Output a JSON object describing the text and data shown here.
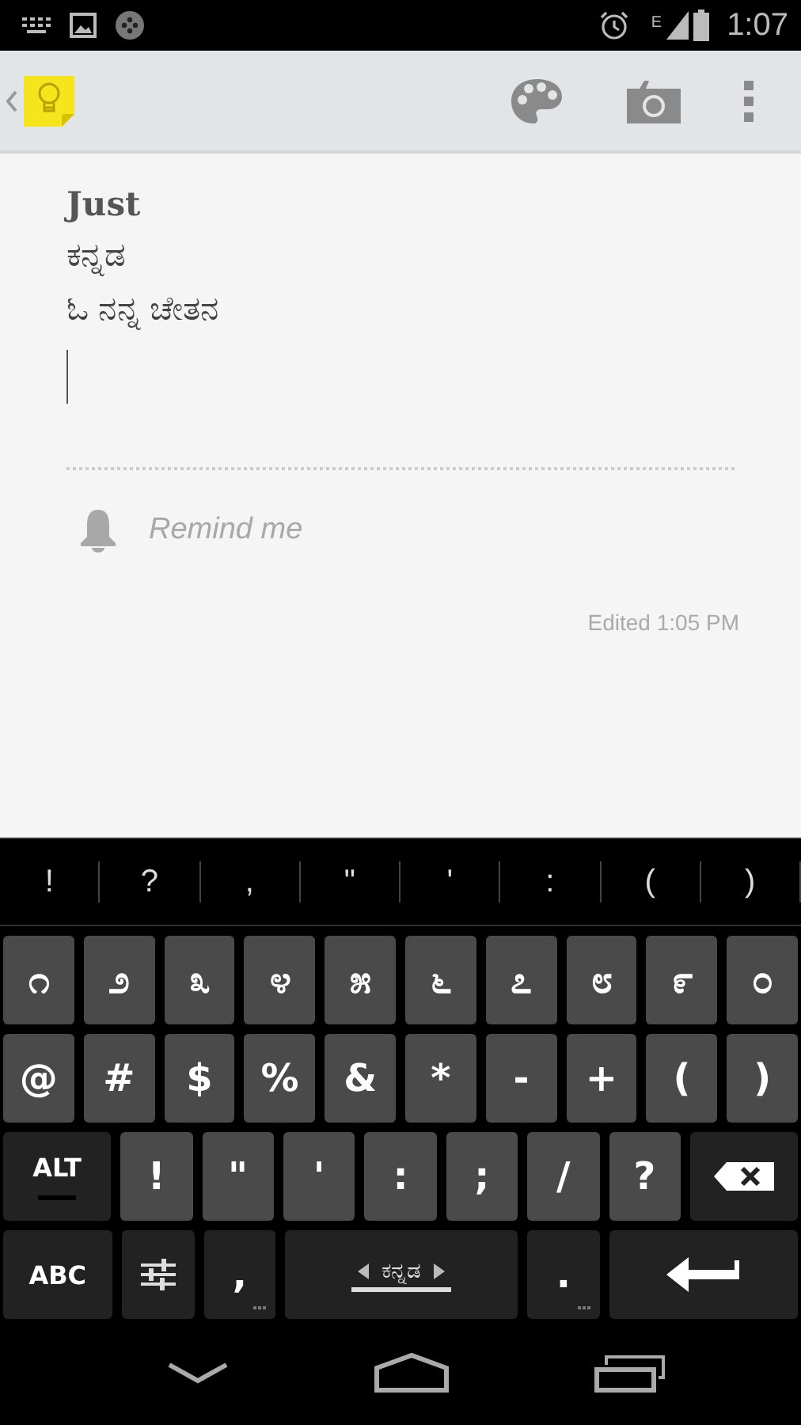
{
  "status_bar": {
    "network": "E",
    "time": "1:07"
  },
  "note": {
    "title": "Just",
    "lines": [
      "ಕನ್ನಡ",
      "ಓ ನನ್ನ ಚೇತನ"
    ],
    "reminder": {
      "placeholder": "Remind me"
    },
    "edited": "Edited 1:05 PM"
  },
  "suggestions": [
    "!",
    "?",
    ",",
    "\"",
    "'",
    ":",
    "(",
    ")"
  ],
  "keyboard": {
    "rows": [
      [
        {
          "kind": "char",
          "label": "೧"
        },
        {
          "kind": "char",
          "label": "೨"
        },
        {
          "kind": "char",
          "label": "೩"
        },
        {
          "kind": "char",
          "label": "೪"
        },
        {
          "kind": "char",
          "label": "೫"
        },
        {
          "kind": "char",
          "label": "೬"
        },
        {
          "kind": "char",
          "label": "೭"
        },
        {
          "kind": "char",
          "label": "೮"
        },
        {
          "kind": "char",
          "label": "೯"
        },
        {
          "kind": "char",
          "label": "೦"
        }
      ],
      [
        {
          "kind": "char",
          "label": "@"
        },
        {
          "kind": "char",
          "label": "#"
        },
        {
          "kind": "char",
          "label": "$"
        },
        {
          "kind": "char",
          "label": "%"
        },
        {
          "kind": "char",
          "label": "&"
        },
        {
          "kind": "char",
          "label": "*"
        },
        {
          "kind": "char",
          "label": "-"
        },
        {
          "kind": "char",
          "label": "+"
        },
        {
          "kind": "char",
          "label": "("
        },
        {
          "kind": "char",
          "label": ")"
        }
      ],
      [
        {
          "kind": "alt",
          "label": "ALT",
          "locked": false
        },
        {
          "kind": "char",
          "label": "!"
        },
        {
          "kind": "char",
          "label": "\""
        },
        {
          "kind": "char",
          "label": "'"
        },
        {
          "kind": "char",
          "label": ":"
        },
        {
          "kind": "char",
          "label": ";"
        },
        {
          "kind": "char",
          "label": "/"
        },
        {
          "kind": "char",
          "label": "?"
        },
        {
          "kind": "backspace"
        }
      ],
      [
        {
          "kind": "abc",
          "label": "ABC"
        },
        {
          "kind": "settings"
        },
        {
          "kind": "punct",
          "label": ",",
          "more": true
        },
        {
          "kind": "space",
          "label": "ಕನ್ನಡ"
        },
        {
          "kind": "punct",
          "label": ".",
          "more": true
        },
        {
          "kind": "enter"
        }
      ]
    ]
  }
}
